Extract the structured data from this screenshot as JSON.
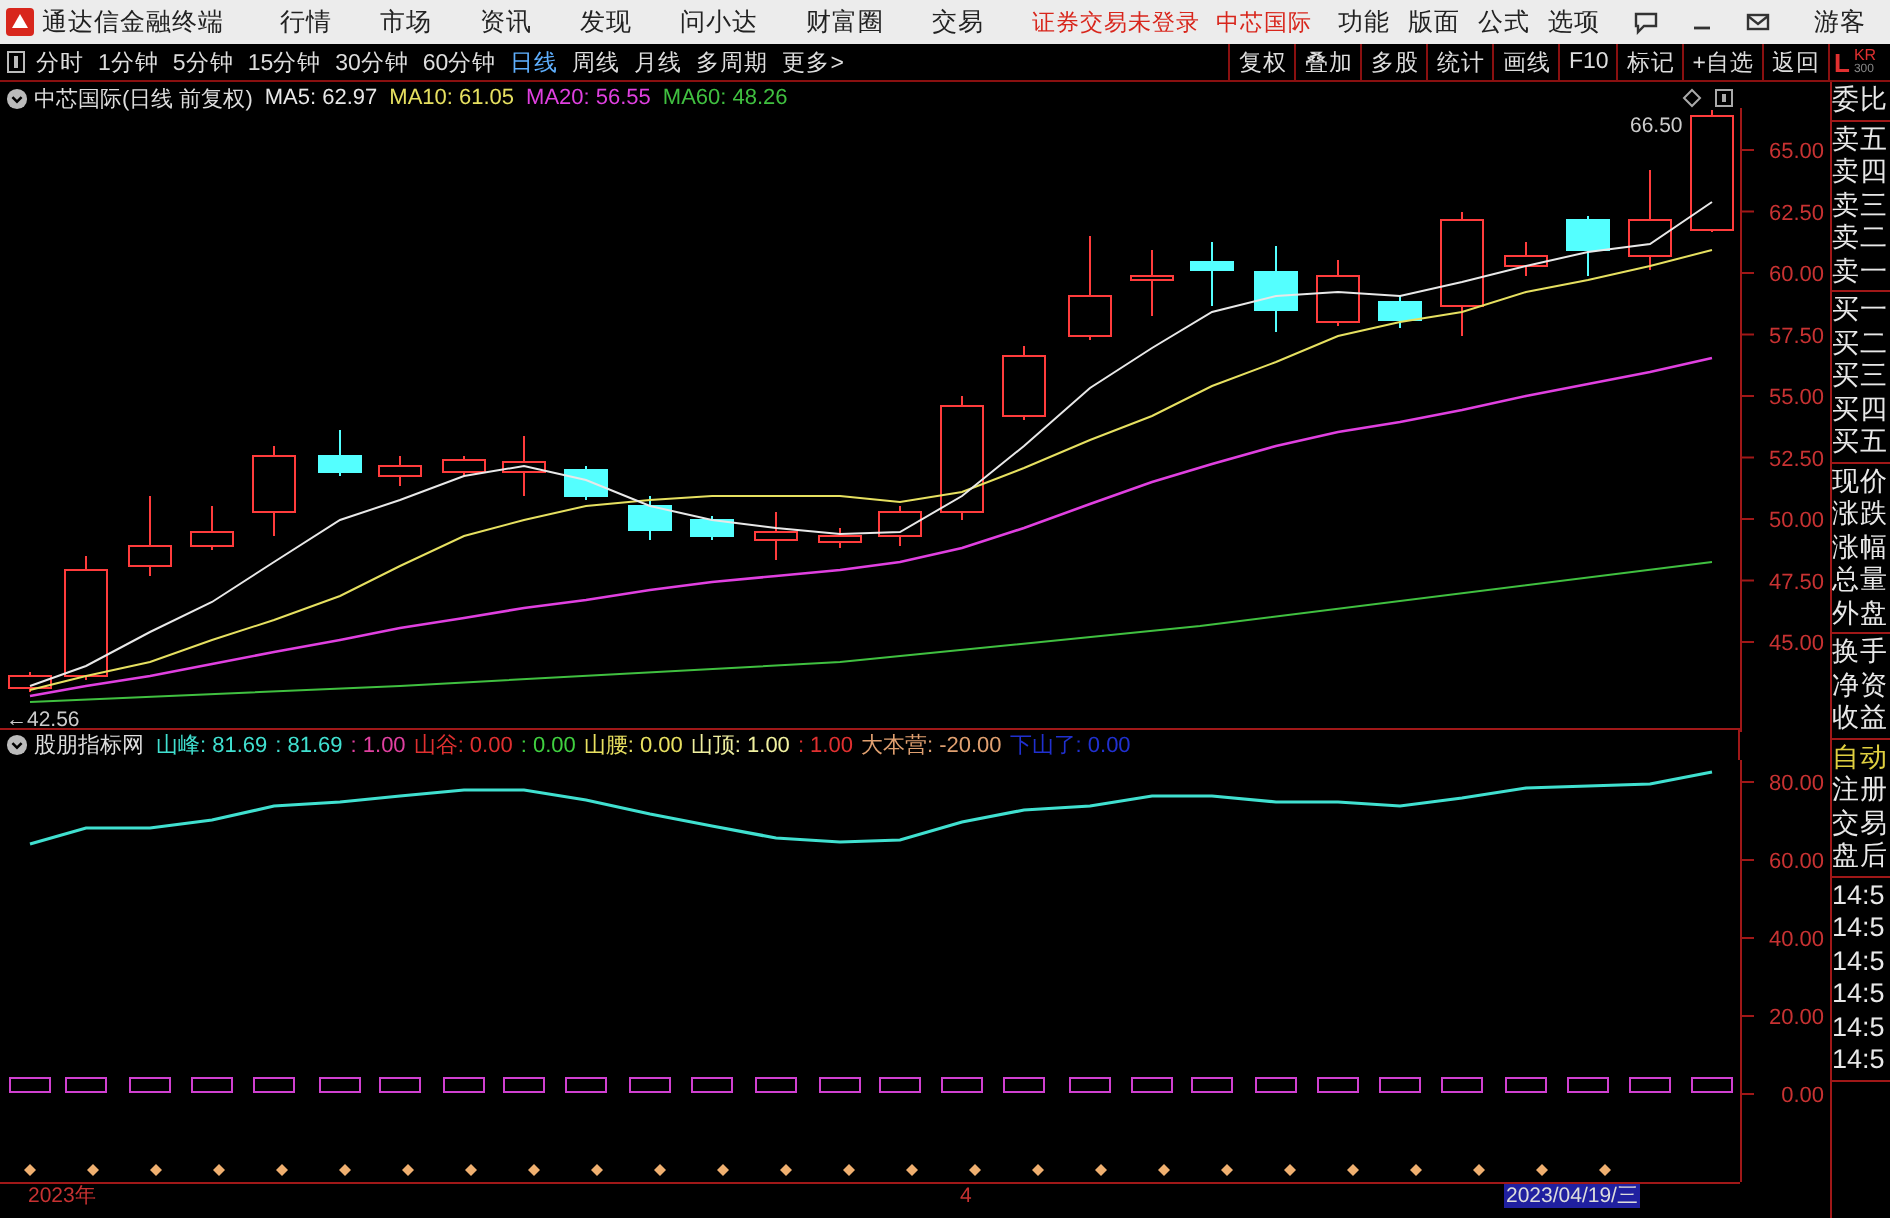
{
  "title_bar": {
    "app_name": "通达信金融终端",
    "menus": [
      "行情",
      "市场",
      "资讯",
      "发现",
      "问小达",
      "财富圈",
      "交易"
    ],
    "notices": [
      "证券交易未登录",
      "中芯国际"
    ],
    "right_menus": [
      "功能",
      "版面",
      "公式",
      "选项"
    ],
    "user": "游客"
  },
  "period_tabs": [
    {
      "label": "分时",
      "selected": false
    },
    {
      "label": "1分钟",
      "selected": false
    },
    {
      "label": "5分钟",
      "selected": false
    },
    {
      "label": "15分钟",
      "selected": false
    },
    {
      "label": "30分钟",
      "selected": false
    },
    {
      "label": "60分钟",
      "selected": false
    },
    {
      "label": "日线",
      "selected": true
    },
    {
      "label": "周线",
      "selected": false
    },
    {
      "label": "月线",
      "selected": false
    },
    {
      "label": "多周期",
      "selected": false
    },
    {
      "label": "更多>",
      "selected": false
    }
  ],
  "tool_buttons": [
    "复权",
    "叠加",
    "多股",
    "统计",
    "画线",
    "F10",
    "标记",
    "+自选",
    "返回"
  ],
  "corner_logo": {
    "letter": "L",
    "code": "KR",
    "sub": "300"
  },
  "main_chart": {
    "title": "中芯国际(日线 前复权)",
    "legend": [
      {
        "label": "MA5: 62.97",
        "color": "#e8e8e8"
      },
      {
        "label": "MA10: 61.05",
        "color": "#e6e060"
      },
      {
        "label": "MA20: 56.55",
        "color": "#e040e0"
      },
      {
        "label": "MA60: 48.26",
        "color": "#40c040"
      }
    ],
    "high_label": "66.50",
    "low_label": "←42.56",
    "axis_labels": [
      "65.00",
      "62.50",
      "60.00",
      "57.50",
      "55.00",
      "52.50",
      "50.00",
      "47.50",
      "45.00"
    ]
  },
  "indicator": {
    "title": "股朋指标网",
    "legend": [
      {
        "label": "山峰: 81.69",
        "color": "#40e0d0"
      },
      {
        "label": ": 81.69",
        "color": "#40e0d0"
      },
      {
        "label": ": 1.00",
        "color": "#e040a0"
      },
      {
        "label": "山谷: 0.00",
        "color": "#e03030"
      },
      {
        "label": ": 0.00",
        "color": "#40d040"
      },
      {
        "label": "山腰: 0.00",
        "color": "#e8e060"
      },
      {
        "label": "山顶: 1.00",
        "color": "#f0f0a0"
      },
      {
        "label": ": 1.00",
        "color": "#e03030"
      },
      {
        "label": "大本营: -20.00",
        "color": "#e0a070"
      },
      {
        "label": "下山了: 0.00",
        "color": "#2030d0"
      }
    ],
    "axis_labels": [
      "80.00",
      "60.00",
      "40.00",
      "20.00",
      "0.00"
    ]
  },
  "date_axis": [
    {
      "label": "2023年",
      "selected": false
    },
    {
      "label": "4",
      "selected": false
    },
    {
      "label": "2023/04/19/三",
      "selected": true
    }
  ],
  "side_panel": {
    "upper": [
      [
        "委比"
      ],
      [
        "卖五",
        "卖四",
        "卖三",
        "卖二",
        "卖一"
      ],
      [
        "买一",
        "买二",
        "买三",
        "买四",
        "买五"
      ],
      [
        "现价",
        "涨跌",
        "涨幅",
        "总量",
        "外盘"
      ],
      [
        "换手",
        "净资",
        "收益"
      ]
    ],
    "lower": [
      [
        {
          "label": "自动",
          "active": true
        },
        {
          "label": "注册",
          "active": false
        },
        {
          "label": "交易",
          "active": false
        },
        {
          "label": "盘后",
          "active": false
        }
      ],
      [
        {
          "label": "14:5",
          "active": false
        },
        {
          "label": "14:5",
          "active": false
        },
        {
          "label": "14:5",
          "active": false
        },
        {
          "label": "14:5",
          "active": false
        },
        {
          "label": "14:5",
          "active": false
        },
        {
          "label": "14:5",
          "active": false
        }
      ]
    ]
  }
}
